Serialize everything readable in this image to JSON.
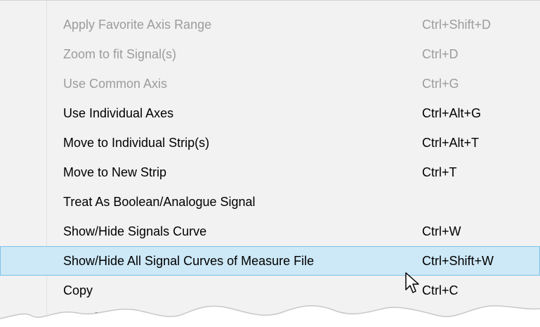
{
  "menu": {
    "items": [
      {
        "label": "Apply Favorite Axis Range",
        "shortcut": "Ctrl+Shift+D",
        "enabled": false
      },
      {
        "label": "Zoom to fit Signal(s)",
        "shortcut": "Ctrl+D",
        "enabled": false
      },
      {
        "label": "Use Common Axis",
        "shortcut": "Ctrl+G",
        "enabled": false
      },
      {
        "label": "Use Individual Axes",
        "shortcut": "Ctrl+Alt+G",
        "enabled": true
      },
      {
        "label": "Move to Individual Strip(s)",
        "shortcut": "Ctrl+Alt+T",
        "enabled": true
      },
      {
        "label": "Move to New Strip",
        "shortcut": "Ctrl+T",
        "enabled": true
      },
      {
        "label": "Treat As Boolean/Analogue Signal",
        "shortcut": "",
        "enabled": true
      },
      {
        "label": "Show/Hide Signals Curve",
        "shortcut": "Ctrl+W",
        "enabled": true
      },
      {
        "label": "Show/Hide All Signal Curves of Measure File",
        "shortcut": "Ctrl+Shift+W",
        "enabled": true,
        "highlighted": true
      },
      {
        "label": "Copy",
        "shortcut": "Ctrl+C",
        "enabled": true
      }
    ],
    "partial_next_item": "...py Cont..."
  },
  "colors": {
    "menu_background": "#f2f2f2",
    "highlight_background": "#cde8f6",
    "highlight_border": "#7ec2e7",
    "disabled_text": "#9c9c9c",
    "enabled_text": "#000000"
  },
  "icons": {
    "cursor": "mouse-pointer-icon"
  }
}
